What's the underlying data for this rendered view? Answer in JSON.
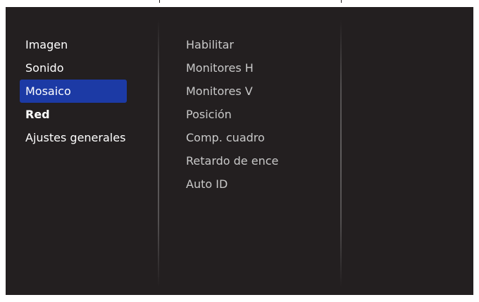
{
  "main_menu": {
    "items": [
      {
        "label": "Imagen"
      },
      {
        "label": "Sonido"
      },
      {
        "label": "Mosaico"
      },
      {
        "label": "Red"
      },
      {
        "label": "Ajustes generales"
      }
    ],
    "selected": "Mosaico"
  },
  "submenu": {
    "items": [
      {
        "label": "Habilitar"
      },
      {
        "label": "Monitores H"
      },
      {
        "label": "Monitores V"
      },
      {
        "label": "Posición"
      },
      {
        "label": "Comp. cuadro"
      },
      {
        "label": "Retardo de ence"
      },
      {
        "label": "Auto ID"
      }
    ]
  },
  "colors": {
    "background": "#231f20",
    "highlight": "#1c3aa5",
    "primary_text": "#ffffff",
    "secondary_text": "#c9c9c9"
  }
}
